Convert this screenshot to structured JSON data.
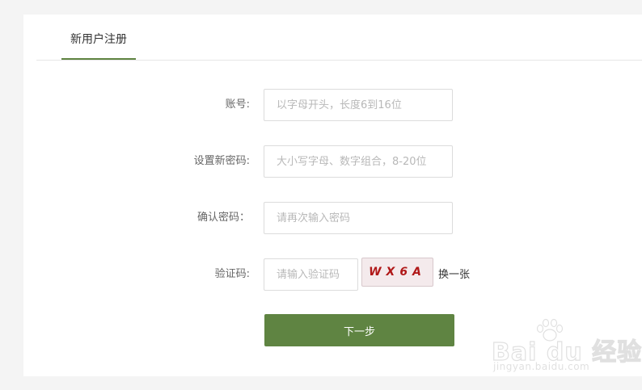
{
  "tabs": {
    "active_label": "新用户注册"
  },
  "form": {
    "account": {
      "label": "账号:",
      "placeholder": "以字母开头，长度6到16位"
    },
    "new_password": {
      "label": "设置新密码:",
      "placeholder": "大小写字母、数字组合，8-20位"
    },
    "confirm_password": {
      "label": "确认密码：",
      "placeholder": "请再次输入密码"
    },
    "captcha": {
      "label": "验证码:",
      "placeholder": "请输入验证码",
      "image_text": "WX6A",
      "refresh_label": "换一张"
    },
    "next_button_label": "下一步"
  },
  "colors": {
    "accent": "#5f8442",
    "captcha_text": "#b01818"
  },
  "watermark": {
    "logo_text": "Bai du 经验",
    "url": "jingyan.baidu.com"
  }
}
